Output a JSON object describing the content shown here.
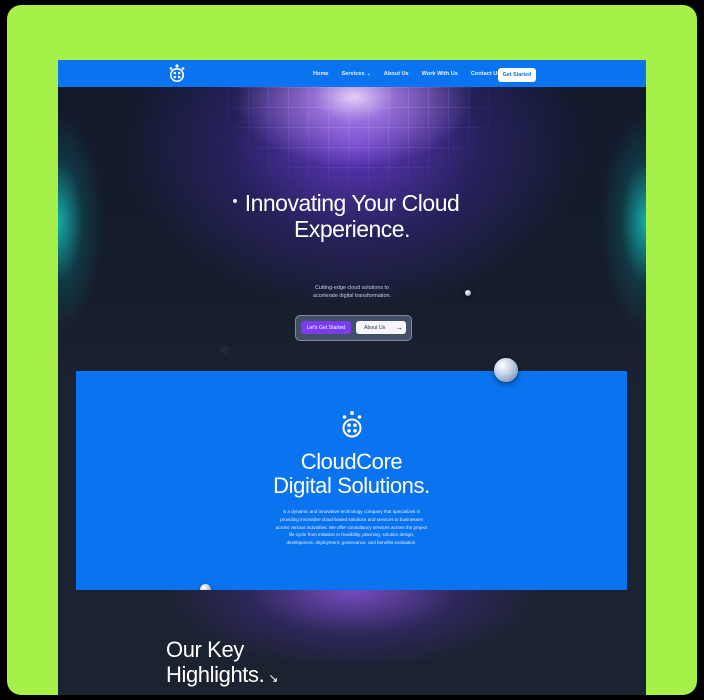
{
  "nav": {
    "links": [
      {
        "label": "Home"
      },
      {
        "label": "Services",
        "has_dropdown": true
      },
      {
        "label": "About Us"
      },
      {
        "label": "Work With Us"
      },
      {
        "label": "Contact Us"
      }
    ],
    "cta": "Get Started"
  },
  "hero": {
    "title_line1": "Innovating Your Cloud",
    "title_line2": "Experience.",
    "subtitle_line1": "Cutting-edge cloud solutions to",
    "subtitle_line2": "accelerate digital transformation.",
    "primary_button": "Let's Get Started",
    "secondary_button": "About Us",
    "secondary_icon": "arrow-right-icon"
  },
  "about": {
    "title_line1": "CloudCore",
    "title_line2": "Digital Solutions.",
    "description_lines": [
      "is a dynamic and innovative technology company that specializes in",
      "providing innovative cloud-based solutions and services to businesses",
      "across various industries. We offer consultancy services across the project",
      "life cycle from initiation to feasibility, planning, solution design,",
      "development, deployment, governance, and benefits evaluation."
    ]
  },
  "highlights": {
    "title_line1": "Our Key",
    "title_line2": "Highlights.",
    "arrow_icon": "arrow-down-right-icon"
  },
  "colors": {
    "frame_background": "#a6f04a",
    "brand_blue": "#0a73f0",
    "primary_purple": "#7b3cf0",
    "dark_background": "#1b2230"
  }
}
